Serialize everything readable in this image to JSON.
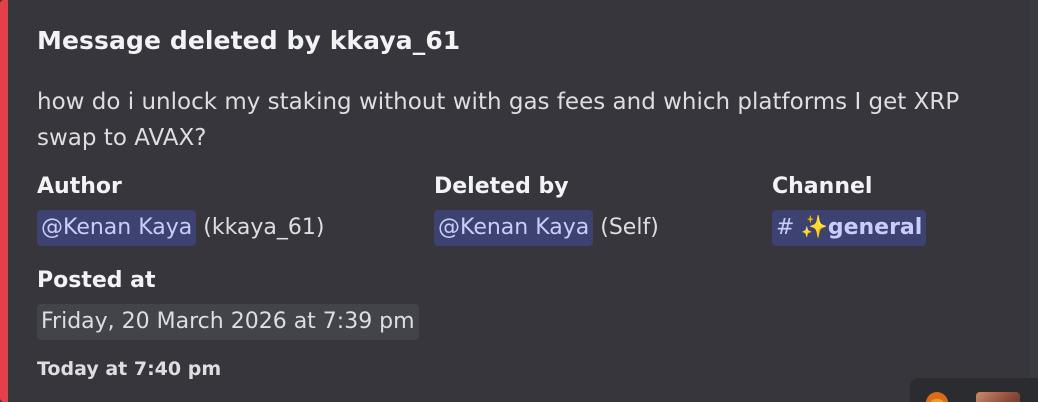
{
  "colors": {
    "accent": "#e5404a",
    "mention_bg": "#3d4270",
    "mention_fg": "#c9cdfb"
  },
  "embed": {
    "title": "Message deleted by kkaya_61",
    "description": "how do i unlock my staking without with gas fees and which platforms I get XRP swap to AVAX?",
    "fields": {
      "author": {
        "name": "Author",
        "mention": "@Kenan Kaya",
        "suffix": "(kkaya_61)"
      },
      "deleted_by": {
        "name": "Deleted by",
        "mention": "@Kenan Kaya",
        "suffix": "(Self)"
      },
      "channel": {
        "name": "Channel",
        "hash": "#",
        "channel_name": "✨general"
      },
      "posted_at": {
        "name": "Posted at",
        "value": "Friday, 20 March 2026 at 7:39 pm"
      }
    },
    "footer": "Today at 7:40 pm"
  },
  "reactions": {
    "emoji_icon": "fire-emoji-icon",
    "avatar_icon": "user-avatar-icon"
  }
}
